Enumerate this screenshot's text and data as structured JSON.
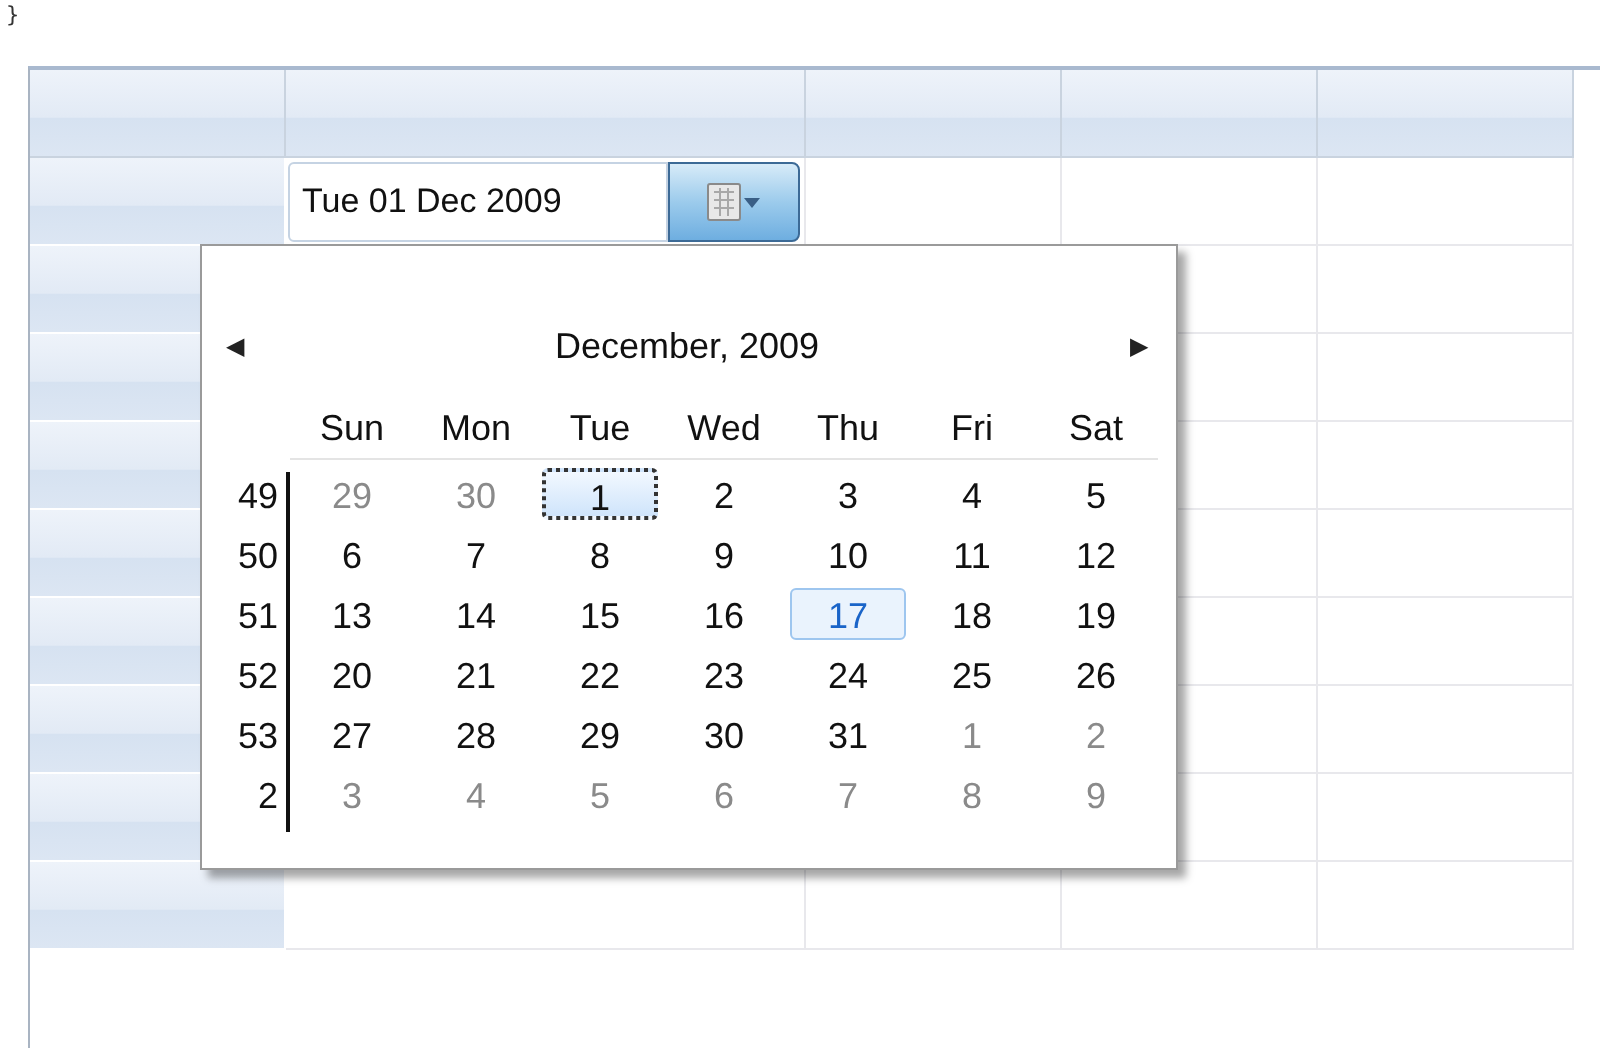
{
  "code_fragment": "}",
  "date_field": {
    "value": "Tue 01 Dec 2009"
  },
  "calendar": {
    "prev_label": "◀",
    "next_label": "▶",
    "title": "December, 2009",
    "weekdays": [
      "Sun",
      "Mon",
      "Tue",
      "Wed",
      "Thu",
      "Fri",
      "Sat"
    ],
    "weeks": [
      {
        "week": "49",
        "days": [
          {
            "text": "29",
            "other_month": true,
            "selected": false,
            "today": false
          },
          {
            "text": "30",
            "other_month": true,
            "selected": false,
            "today": false
          },
          {
            "text": "1",
            "other_month": false,
            "selected": true,
            "today": false
          },
          {
            "text": "2",
            "other_month": false,
            "selected": false,
            "today": false
          },
          {
            "text": "3",
            "other_month": false,
            "selected": false,
            "today": false
          },
          {
            "text": "4",
            "other_month": false,
            "selected": false,
            "today": false
          },
          {
            "text": "5",
            "other_month": false,
            "selected": false,
            "today": false
          }
        ]
      },
      {
        "week": "50",
        "days": [
          {
            "text": "6",
            "other_month": false,
            "selected": false,
            "today": false
          },
          {
            "text": "7",
            "other_month": false,
            "selected": false,
            "today": false
          },
          {
            "text": "8",
            "other_month": false,
            "selected": false,
            "today": false
          },
          {
            "text": "9",
            "other_month": false,
            "selected": false,
            "today": false
          },
          {
            "text": "10",
            "other_month": false,
            "selected": false,
            "today": false
          },
          {
            "text": "11",
            "other_month": false,
            "selected": false,
            "today": false
          },
          {
            "text": "12",
            "other_month": false,
            "selected": false,
            "today": false
          }
        ]
      },
      {
        "week": "51",
        "days": [
          {
            "text": "13",
            "other_month": false,
            "selected": false,
            "today": false
          },
          {
            "text": "14",
            "other_month": false,
            "selected": false,
            "today": false
          },
          {
            "text": "15",
            "other_month": false,
            "selected": false,
            "today": false
          },
          {
            "text": "16",
            "other_month": false,
            "selected": false,
            "today": false
          },
          {
            "text": "17",
            "other_month": false,
            "selected": false,
            "today": true
          },
          {
            "text": "18",
            "other_month": false,
            "selected": false,
            "today": false
          },
          {
            "text": "19",
            "other_month": false,
            "selected": false,
            "today": false
          }
        ]
      },
      {
        "week": "52",
        "days": [
          {
            "text": "20",
            "other_month": false,
            "selected": false,
            "today": false
          },
          {
            "text": "21",
            "other_month": false,
            "selected": false,
            "today": false
          },
          {
            "text": "22",
            "other_month": false,
            "selected": false,
            "today": false
          },
          {
            "text": "23",
            "other_month": false,
            "selected": false,
            "today": false
          },
          {
            "text": "24",
            "other_month": false,
            "selected": false,
            "today": false
          },
          {
            "text": "25",
            "other_month": false,
            "selected": false,
            "today": false
          },
          {
            "text": "26",
            "other_month": false,
            "selected": false,
            "today": false
          }
        ]
      },
      {
        "week": "53",
        "days": [
          {
            "text": "27",
            "other_month": false,
            "selected": false,
            "today": false
          },
          {
            "text": "28",
            "other_month": false,
            "selected": false,
            "today": false
          },
          {
            "text": "29",
            "other_month": false,
            "selected": false,
            "today": false
          },
          {
            "text": "30",
            "other_month": false,
            "selected": false,
            "today": false
          },
          {
            "text": "31",
            "other_month": false,
            "selected": false,
            "today": false
          },
          {
            "text": "1",
            "other_month": true,
            "selected": false,
            "today": false
          },
          {
            "text": "2",
            "other_month": true,
            "selected": false,
            "today": false
          }
        ]
      },
      {
        "week": "2",
        "days": [
          {
            "text": "3",
            "other_month": true,
            "selected": false,
            "today": false
          },
          {
            "text": "4",
            "other_month": true,
            "selected": false,
            "today": false
          },
          {
            "text": "5",
            "other_month": true,
            "selected": false,
            "today": false
          },
          {
            "text": "6",
            "other_month": true,
            "selected": false,
            "today": false
          },
          {
            "text": "7",
            "other_month": true,
            "selected": false,
            "today": false
          },
          {
            "text": "8",
            "other_month": true,
            "selected": false,
            "today": false
          },
          {
            "text": "9",
            "other_month": true,
            "selected": false,
            "today": false
          }
        ]
      }
    ]
  }
}
